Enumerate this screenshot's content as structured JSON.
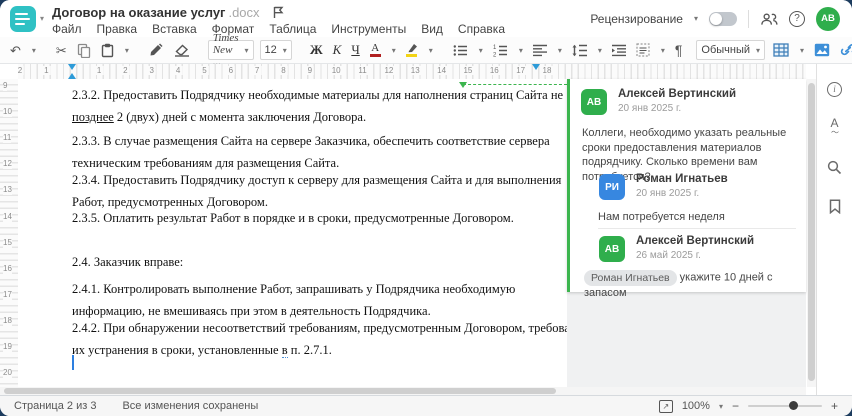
{
  "window": {
    "title": "Договор на оказание услуг",
    "title_ext": ".docx"
  },
  "menu": {
    "items": [
      "Файл",
      "Правка",
      "Вставка",
      "Формат",
      "Таблица",
      "Инструменты",
      "Вид",
      "Справка"
    ]
  },
  "header_right": {
    "review_label": "Рецензирование",
    "avatar_initials": "АВ",
    "help_label": "?"
  },
  "toolbar": {
    "font_name": "Times New ...",
    "font_size": "12",
    "bold_label": "Ж",
    "italic_label": "К",
    "underline_label": "Ч",
    "font_color_label": "А",
    "style_name": "Обычный",
    "pilcrow": "¶",
    "more_label": "..."
  },
  "rulers": {
    "h": [
      "2",
      "1",
      "",
      "1",
      "2",
      "3",
      "4",
      "5",
      "6",
      "7",
      "8",
      "9",
      "10",
      "11",
      "12",
      "13",
      "14",
      "15",
      "16",
      "17",
      "18"
    ],
    "v": [
      "9",
      "10",
      "11",
      "12",
      "13",
      "14",
      "15",
      "16",
      "17",
      "18",
      "19",
      "20"
    ]
  },
  "document": {
    "p1": {
      "pre": "2.3.2. Предоставить Подрядчику необходимые материалы для наполнения страниц Сайта не\n",
      "marked": "позднее",
      "post": " 2 (двух) дней с момента заключения Договора."
    },
    "p2": "2.3.3. В случае размещения Сайта на сервере Заказчика, обеспечить соответствие сервера\nтехническим требованиям для размещения Сайта.",
    "p3": "2.3.4. Предоставить Подрядчику доступ к серверу для размещения Сайта и для выполнения\nРабот, предусмотренных Договором.",
    "p4": "2.3.5. Оплатить результат Работ в порядке и в сроки, предусмотренные Договором.",
    "p5": "2.4. Заказчик вправе:",
    "p6": "2.4.1. Контролировать выполнение Работ, запрашивать у Подрядчика необходимую\nинформацию, не вмешиваясь при этом в деятельность Подрядчика.",
    "p7": {
      "pre": "2.4.2. При обнаружении несоответствий требованиям, предусмотренным Договором, требовать\nих устранения в сроки, установленные ",
      "marked": "в",
      "post": " п. 2.7.1."
    }
  },
  "comments": [
    {
      "initials": "АВ",
      "name": "Алексей Вертинский",
      "date": "20 янв 2025 г.",
      "text": "Коллеги, необходимо указать реальные сроки предоставления материалов подрядчику. Сколько времени вам потребуется?",
      "color": "#2fae4c"
    },
    {
      "initials": "РИ",
      "name": "Роман Игнатьев",
      "date": "20 янв 2025 г.",
      "text": "Нам потребуется неделя",
      "color": "#3787e0"
    },
    {
      "initials": "АВ",
      "name": "Алексей Вертинский",
      "date": "26 май 2025 г.",
      "mention": "Роман Игнатьев",
      "text": "укажите 10 дней с запасом",
      "color": "#2fae4c"
    }
  ],
  "status_bar": {
    "page_label": "Страница 2 из 3",
    "saved_label": "Все изменения сохранены",
    "zoom_value": "100%"
  },
  "colors": {
    "accent_teal": "#2fc1c4",
    "accent_green": "#3cb54e",
    "avatar_green": "#2fae4c",
    "avatar_blue": "#3787e0",
    "marker_blue": "#2d9bd8"
  }
}
